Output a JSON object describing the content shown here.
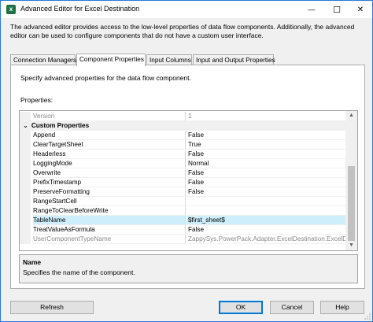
{
  "window": {
    "title": "Advanced Editor for Excel Destination",
    "controls": {
      "minimize": "—",
      "maximize": "☐",
      "close": "✕"
    }
  },
  "description": "The advanced editor provides access to the low-level properties of data flow components. Additionally, the advanced editor can be used to configure components that do not have a custom user interface.",
  "tabs": [
    {
      "label": "Connection Managers",
      "active": false
    },
    {
      "label": "Component Properties",
      "active": true
    },
    {
      "label": "Input Columns",
      "active": false
    },
    {
      "label": "Input and Output Properties",
      "active": false
    }
  ],
  "panel": {
    "instruction": "Specify advanced properties for the data flow component.",
    "properties_label": "Properties:"
  },
  "grid": {
    "rows": [
      {
        "name": "Version",
        "value": "1",
        "kind": "dim"
      },
      {
        "name": "Custom Properties",
        "value": "",
        "kind": "category",
        "toggle": "⌄"
      },
      {
        "name": "Append",
        "value": "False",
        "kind": "prop"
      },
      {
        "name": "ClearTargetSheet",
        "value": "True",
        "kind": "prop"
      },
      {
        "name": "Headerless",
        "value": "False",
        "kind": "prop"
      },
      {
        "name": "LoggingMode",
        "value": "Normal",
        "kind": "prop"
      },
      {
        "name": "Overwrite",
        "value": "False",
        "kind": "prop"
      },
      {
        "name": "PrefixTimestamp",
        "value": "False",
        "kind": "prop"
      },
      {
        "name": "PreserveFormatting",
        "value": "False",
        "kind": "prop"
      },
      {
        "name": "RangeStartCell",
        "value": "",
        "kind": "prop"
      },
      {
        "name": "RangeToClearBeforeWrite",
        "value": "",
        "kind": "prop"
      },
      {
        "name": "TableName",
        "value": "$first_sheet$",
        "kind": "selected"
      },
      {
        "name": "TreatValueAsFormula",
        "value": "False",
        "kind": "prop"
      },
      {
        "name": "UserComponentTypeName",
        "value": "ZappySys.PowerPack.Adapter.ExcelDestination.ExcelDestinati",
        "kind": "dim"
      }
    ]
  },
  "help": {
    "title": "Name",
    "text": "Specifies the name of the component."
  },
  "buttons": {
    "refresh": "Refresh",
    "ok": "OK",
    "cancel": "Cancel",
    "help": "Help"
  },
  "colors": {
    "selected_row": "#cdeefa",
    "window_border": "#2b79d7",
    "default_button": "#0078d7"
  }
}
